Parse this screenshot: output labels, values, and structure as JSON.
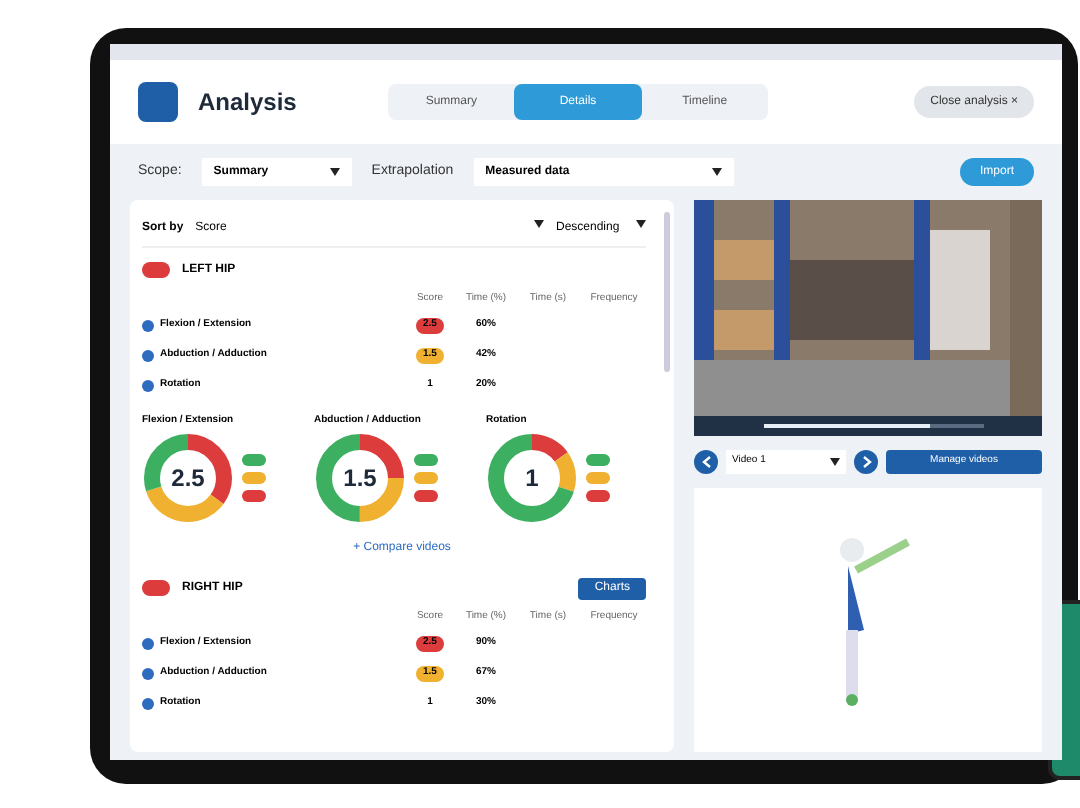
{
  "header": {
    "title": "Analysis",
    "tabs": [
      {
        "label": "Summary",
        "selected": false
      },
      {
        "label": "Details",
        "selected": true
      },
      {
        "label": "Timeline",
        "selected": false
      }
    ],
    "close_button": "Close analysis ×"
  },
  "filters": [
    {
      "label": "Scope:",
      "value": "Summary"
    },
    {
      "label": "Extrapolation",
      "value": "Measured data"
    }
  ],
  "import_button": "Import",
  "sort": {
    "label": "Sort by",
    "value": "Score",
    "order": "Descending"
  },
  "sections": [
    {
      "title": "LEFT HIP",
      "columns": [
        "Score",
        "Time (%)",
        "Time (s)",
        "Frequency"
      ],
      "rows": [
        {
          "name": "Flexion / Extension",
          "score": "2.5",
          "color": "#dc3c3c",
          "time_pct": "60%"
        },
        {
          "name": "Abduction / Adduction",
          "score": "1.5",
          "color": "#f0b030",
          "time_pct": "42%"
        },
        {
          "name": "Rotation",
          "score": "1",
          "color": "#ffffff",
          "time_pct": "20%"
        }
      ],
      "donuts": [
        {
          "title": "Flexion / Extension",
          "value": "2.5"
        },
        {
          "title": "Abduction / Adduction",
          "value": "1.5"
        },
        {
          "title": "Rotation",
          "value": "1"
        }
      ],
      "link": "+ Compare videos"
    },
    {
      "title": "RIGHT HIP",
      "button": "Charts",
      "columns": [
        "Score",
        "Time (%)",
        "Time (s)",
        "Frequency"
      ],
      "rows": [
        {
          "name": "Flexion / Extension",
          "score": "2.5",
          "color": "#dc3c3c",
          "time_pct": "90%"
        },
        {
          "name": "Abduction / Adduction",
          "score": "1.5",
          "color": "#f0b030",
          "time_pct": "67%"
        },
        {
          "name": "Rotation",
          "score": "1",
          "color": "#ffffff",
          "time_pct": "30%"
        }
      ]
    }
  ],
  "video": {
    "selector": "Video 1",
    "button": "Manage videos",
    "progress": {
      "level": 0.75
    }
  }
}
